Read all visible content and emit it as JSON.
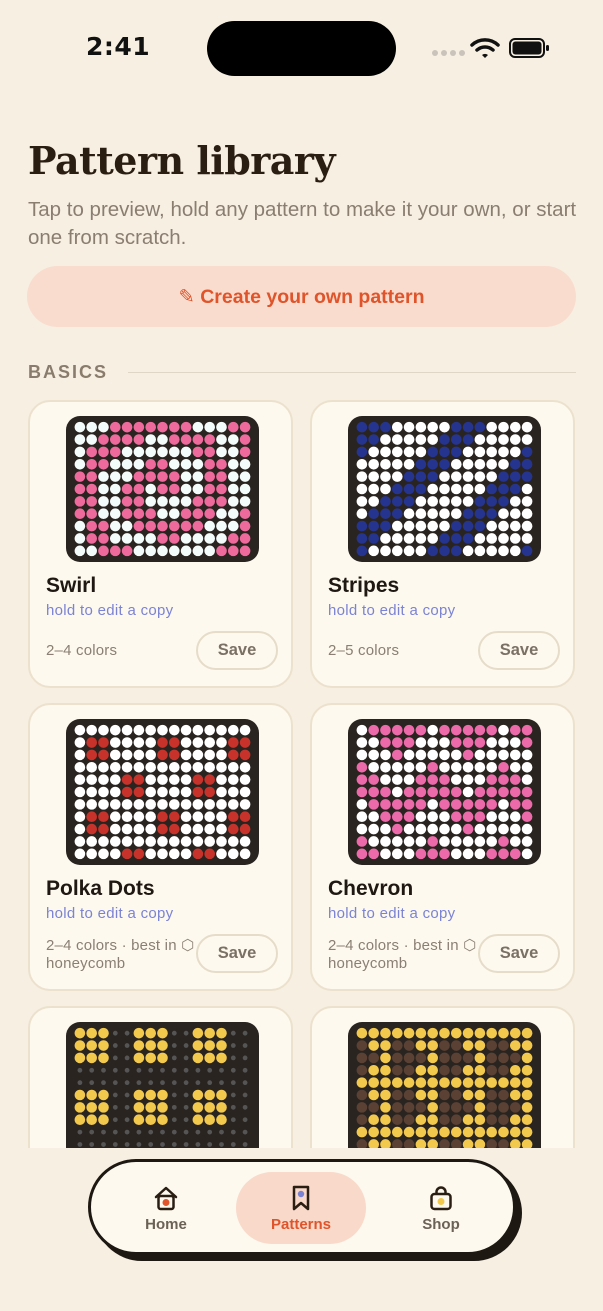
{
  "status": {
    "time": "2:41"
  },
  "header": {
    "title": "Pattern library",
    "subtitle": "Tap to preview, hold any pattern to make it your own, or start one from scratch."
  },
  "create_button": {
    "icon": "pencil-icon",
    "label": "✎ Create your own pattern"
  },
  "section": {
    "label": "BASICS"
  },
  "cards": [
    {
      "title": "Swirl",
      "hint": "hold to edit a copy",
      "meta": "2–4 colors",
      "save": "Save",
      "colors": [
        "#ee6a9c",
        "#f4fbfb"
      ]
    },
    {
      "title": "Stripes",
      "hint": "hold to edit a copy",
      "meta": "2–5 colors",
      "save": "Save",
      "colors": [
        "#25348e",
        "#ffffff"
      ]
    },
    {
      "title": "Polka Dots",
      "hint": "hold to edit a copy",
      "meta": "2–4 colors · best in ⬡ honeycomb",
      "save": "Save",
      "colors": [
        "#c7322a",
        "#ffffff"
      ]
    },
    {
      "title": "Chevron",
      "hint": "hold to edit a copy",
      "meta": "2–4 colors · best in ⬡ honeycomb",
      "save": "Save",
      "colors": [
        "#ec6aa9",
        "#ffffff"
      ]
    },
    {
      "title": "",
      "hint": "",
      "meta": "",
      "save": "",
      "colors": [
        "#f2c94c",
        "#1a1a1a"
      ]
    },
    {
      "title": "",
      "hint": "",
      "meta": "",
      "save": "",
      "colors": [
        "#f2c94c",
        "#5b4134"
      ]
    }
  ],
  "tabbar": {
    "items": [
      {
        "label": "Home",
        "icon": "home-icon"
      },
      {
        "label": "Patterns",
        "icon": "bookmark-icon",
        "active": true
      },
      {
        "label": "Shop",
        "icon": "shopping-bag-icon"
      }
    ]
  },
  "colors": {
    "accent": "#e0542b",
    "accent_soft": "#f9dccd",
    "background": "#f6efe2",
    "card": "#fdf9ee",
    "hint": "#7b83d4"
  }
}
